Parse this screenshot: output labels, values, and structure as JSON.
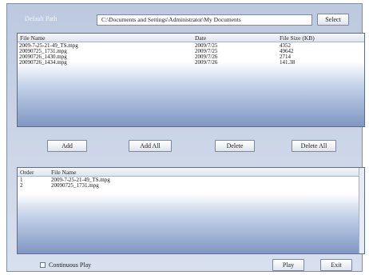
{
  "header": {
    "default_path_label": "Default Path",
    "path_value": "C:\\Documents and Settings\\Administrator\\My Documents",
    "select_label": "Select"
  },
  "file_list": {
    "columns": [
      "File Name",
      "Date",
      "File Size (KB)"
    ],
    "rows": [
      {
        "name": "2009-7-25-21-49_TS.mpg",
        "date": "2009/7/25",
        "size": "4352"
      },
      {
        "name": "20090725_1731.mpg",
        "date": "2009/7/25",
        "size": "49642"
      },
      {
        "name": "20090726_1430.mpg",
        "date": "2009/7/26",
        "size": "2714"
      },
      {
        "name": "20090726_1434.mpg",
        "date": "2009/7/26",
        "size": "141.38"
      }
    ]
  },
  "actions": {
    "add": "Add",
    "add_all": "Add All",
    "delete": "Delete",
    "delete_all": "Delete All"
  },
  "playlist": {
    "columns": [
      "Order",
      "File Name"
    ],
    "rows": [
      {
        "order": "1",
        "name": "2009-7-25-21-49_TS.mpg"
      },
      {
        "order": "2",
        "name": "20090725_1731.mpg"
      }
    ]
  },
  "footer": {
    "continuous_play": "Continuous Play",
    "play": "Play",
    "exit": "Exit"
  }
}
